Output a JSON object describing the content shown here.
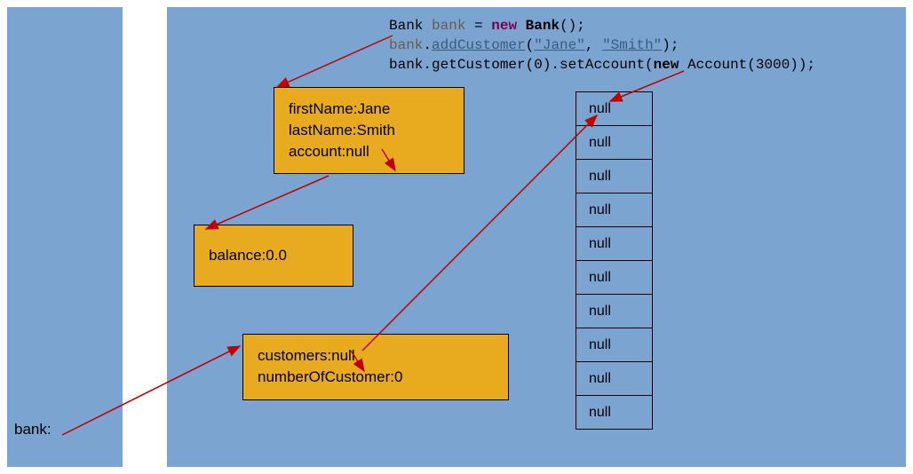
{
  "leftLabel": "bank:",
  "code": {
    "line1": {
      "t1": "Bank ",
      "t2": "bank",
      "t3": " = ",
      "t4": "new",
      "t5": " ",
      "t6": "Bank",
      "t7": "();"
    },
    "line2": {
      "t1": "bank",
      "t2": ".",
      "t3": "addCustomer",
      "t4": "(",
      "t5": "\"Jane\"",
      "t6": ", ",
      "t7": "\"Smith\"",
      "t8": ");"
    },
    "line3": {
      "t1": "bank.getCustomer(0).setAccount(",
      "t2": "new",
      "t3": " Account(3000));"
    }
  },
  "customerBox": {
    "l1": "firstName:Jane",
    "l2": "lastName:Smith",
    "l3": "account:null"
  },
  "balanceBox": {
    "l1": "balance:0.0"
  },
  "bankBox": {
    "l1": "customers:null",
    "l2": "numberOfCustomer:0"
  },
  "arrayCells": [
    "null",
    "null",
    "null",
    "null",
    "null",
    "null",
    "null",
    "null",
    "null",
    "null"
  ]
}
